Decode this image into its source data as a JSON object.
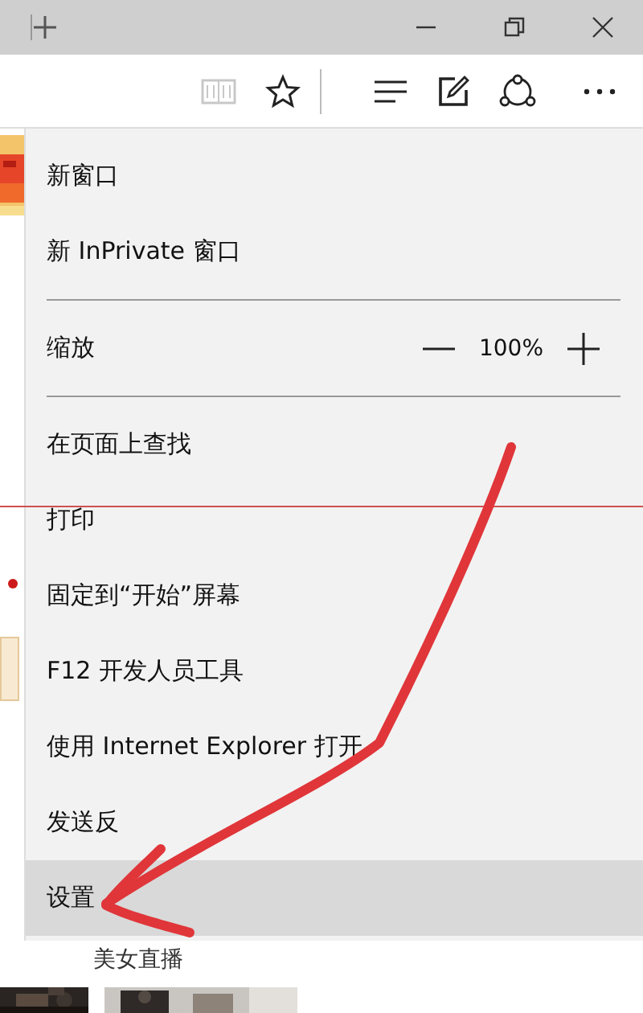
{
  "toolbar": {
    "reading_view": {
      "disabled": true
    }
  },
  "menu": {
    "sections": [
      [
        {
          "kind": "item",
          "label": "新窗口",
          "selected": false
        },
        {
          "kind": "item",
          "label": "新 InPrivate 窗口",
          "selected": false
        }
      ],
      [
        {
          "kind": "zoom",
          "label": "缩放",
          "value": "100%",
          "selected": false
        }
      ],
      [
        {
          "kind": "item",
          "label": "在页面上查找",
          "selected": false
        },
        {
          "kind": "item",
          "label": "打印",
          "selected": false
        },
        {
          "kind": "item",
          "label": "固定到“开始”屏幕",
          "selected": false
        },
        {
          "kind": "item",
          "label": "F12 开发人员工具",
          "selected": false
        },
        {
          "kind": "item",
          "label": "使用 Internet Explorer 打开",
          "selected": false
        },
        {
          "kind": "item",
          "label": "发送反",
          "selected": false
        },
        {
          "kind": "item",
          "label": "设置",
          "selected": true
        }
      ]
    ]
  },
  "page": {
    "links": [
      "美女直播"
    ]
  }
}
